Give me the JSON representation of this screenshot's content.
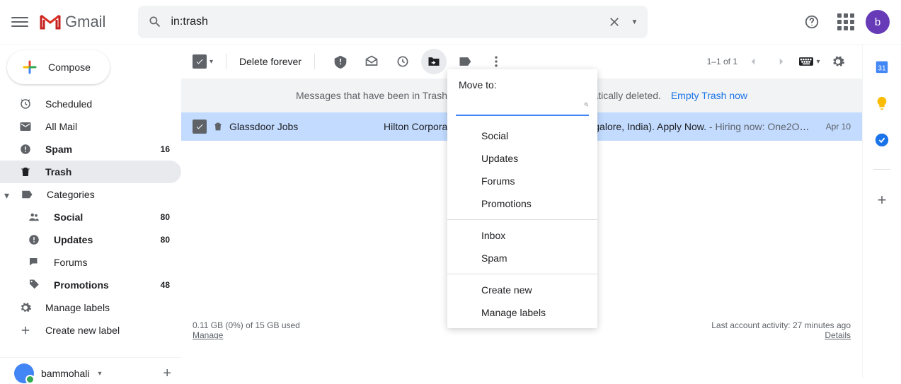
{
  "header": {
    "app_name": "Gmail",
    "search_value": "in:trash",
    "avatar_letter": "b"
  },
  "compose_label": "Compose",
  "sidebar": {
    "items": [
      {
        "icon": "scheduled",
        "label": "Scheduled",
        "count": "",
        "bold": false
      },
      {
        "icon": "all-mail",
        "label": "All Mail",
        "count": "",
        "bold": false
      },
      {
        "icon": "spam",
        "label": "Spam",
        "count": "16",
        "bold": true
      },
      {
        "icon": "trash",
        "label": "Trash",
        "count": "",
        "bold": true,
        "active": true
      },
      {
        "icon": "categories",
        "label": "Categories",
        "count": "",
        "bold": false,
        "expand": true
      }
    ],
    "categories": [
      {
        "icon": "social",
        "label": "Social",
        "count": "80"
      },
      {
        "icon": "updates",
        "label": "Updates",
        "count": "80"
      },
      {
        "icon": "forums",
        "label": "Forums",
        "count": ""
      },
      {
        "icon": "promotions",
        "label": "Promotions",
        "count": "48"
      }
    ],
    "manage_labels": "Manage labels",
    "create_label": "Create new label",
    "user": "bammohali"
  },
  "toolbar": {
    "delete_forever": "Delete forever",
    "range": "1–1 of 1"
  },
  "banner": {
    "text": "Messages that have been in Trash more than 30 days will be automatically deleted.",
    "link": "Empty Trash now"
  },
  "email": {
    "sender": "Glassdoor Jobs",
    "subject": "Hilton Corporate is hiring a Sales Manager (Bangalore, India). Apply Now.",
    "snippet": " - Hiring now: One2One…",
    "date": "Apr 10"
  },
  "footer": {
    "storage": "0.11 GB (0%) of 15 GB used",
    "manage": "Manage",
    "activity": "Last account activity: 27 minutes ago",
    "details": "Details"
  },
  "dropdown": {
    "title": "Move to:",
    "section1": [
      "Social",
      "Updates",
      "Forums",
      "Promotions"
    ],
    "section2": [
      "Inbox",
      "Spam"
    ],
    "section3": [
      "Create new",
      "Manage labels"
    ]
  }
}
